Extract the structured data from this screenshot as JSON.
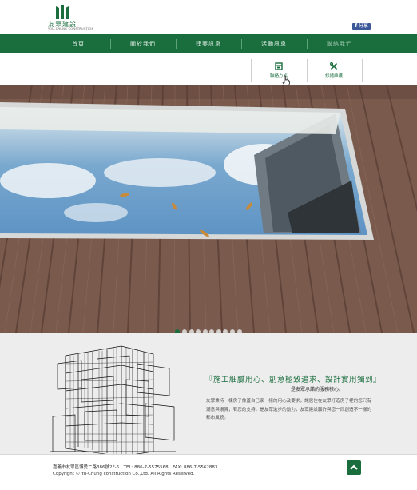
{
  "brand": {
    "name": "友眾建設",
    "sub": "YOU-CHUNG CONSTRUCTION"
  },
  "share": {
    "label": "分享"
  },
  "nav": {
    "items": [
      {
        "label": "首頁"
      },
      {
        "label": "關於我們"
      },
      {
        "label": "建案訊息"
      },
      {
        "label": "活動訊息"
      },
      {
        "label": "聯絡我們"
      }
    ]
  },
  "submenu": {
    "items": [
      {
        "label": "聯絡方式",
        "icon": "contact-book-icon"
      },
      {
        "label": "修繕維護",
        "icon": "tools-icon"
      }
    ]
  },
  "slider": {
    "count": 10,
    "active_index": 0
  },
  "intro": {
    "headline": "『施工細膩用心、創意極致追求、設計實用獨到』",
    "tagline": "是友眾承諾的服務核心。",
    "body": "友眾秉持一棟房子像蓋自己家一樣的用心及要求，讓居住在友眾打造房子裡的您只有滿意與讚賞，有您的支持，是友眾進步的動力，友眾建設願許與您一同創造不一樣的都市風貌。"
  },
  "footer": {
    "address": "嘉義市友眾區博愛二路386號2F-6　TEL: 886-7-5575568　FAX: 886-7-5562883",
    "copyright": "Copyright © Yu-Chung construction Co.,Ltd. All Rights Reserved."
  },
  "colors": {
    "brand_green": "#1a6e3e",
    "deck_brown": "#7a5a4c"
  }
}
